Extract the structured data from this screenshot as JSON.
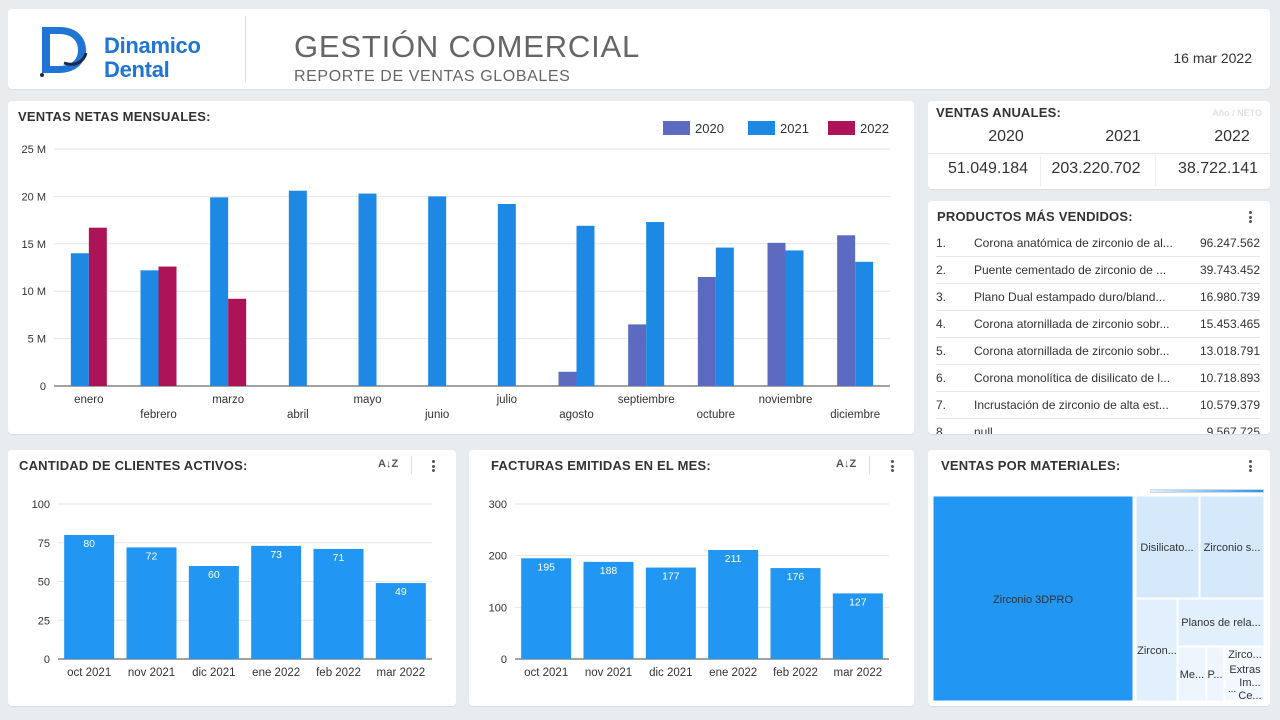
{
  "header": {
    "logo_line1": "Dinamico",
    "logo_line2": "Dental",
    "title": "GESTIÓN COMERCIAL",
    "subtitle": "REPORTE DE VENTAS GLOBALES",
    "date": "16 mar 2022"
  },
  "colors": {
    "c2020": "#5c6bc0",
    "c2021": "#1e88e5",
    "c2022": "#ad1457",
    "bar": "#2196f3",
    "treemap_main": "#2196f3",
    "treemap_light": "#d6e9fb"
  },
  "monthly": {
    "title": "VENTAS NETAS MENSUALES:",
    "legend": [
      "2020",
      "2021",
      "2022"
    ]
  },
  "annual": {
    "title": "VENTAS ANUALES:",
    "hint": "Año / NETO",
    "years": [
      "2020",
      "2021",
      "2022"
    ],
    "values": [
      "51.049.184",
      "203.220.702",
      "38.722.141"
    ]
  },
  "products": {
    "title": "PRODUCTOS MÁS VENDIDOS:",
    "rows": [
      {
        "idx": "1.",
        "name": "Corona anatómica de zirconio de al...",
        "value": "96.247.562"
      },
      {
        "idx": "2.",
        "name": "Puente cementado de zirconio de ...",
        "value": "39.743.452"
      },
      {
        "idx": "3.",
        "name": "Plano Dual estampado duro/bland...",
        "value": "16.980.739"
      },
      {
        "idx": "4.",
        "name": "Corona atornillada de zirconio sobr...",
        "value": "15.453.465"
      },
      {
        "idx": "5.",
        "name": "Corona atornillada de zirconio sobr...",
        "value": "13.018.791"
      },
      {
        "idx": "6.",
        "name": "Corona monolítica de disilicato de l...",
        "value": "10.718.893"
      },
      {
        "idx": "7.",
        "name": "Incrustación de zirconio de alta est...",
        "value": "10.579.379"
      },
      {
        "idx": "8.",
        "name": "null",
        "value": "9.567.725"
      }
    ]
  },
  "clients": {
    "title": "CANTIDAD DE CLIENTES ACTIVOS:"
  },
  "invoices": {
    "title": "FACTURAS EMITIDAS EN EL MES:"
  },
  "materials": {
    "title": "VENTAS POR MATERIALES:",
    "labels": {
      "main": "Zirconio 3DPRO",
      "disilicato": "Disilicato...",
      "zirconio_s": "Zirconio s...",
      "planos": "Planos de rela...",
      "zircon": "Zircon...",
      "me": "Me...",
      "p": "P...",
      "zirco": "Zirco...",
      "extras": "Extras",
      "im": "Im...",
      "dots": "...",
      "ce": "Ce..."
    }
  },
  "chart_data": [
    {
      "type": "bar",
      "title": "VENTAS NETAS MENSUALES:",
      "categories": [
        "enero",
        "febrero",
        "marzo",
        "abril",
        "mayo",
        "junio",
        "julio",
        "agosto",
        "septiembre",
        "octubre",
        "noviembre",
        "diciembre"
      ],
      "series": [
        {
          "name": "2020",
          "values": [
            null,
            null,
            null,
            null,
            null,
            null,
            null,
            1.5,
            6.5,
            11.5,
            15.1,
            15.9
          ]
        },
        {
          "name": "2021",
          "values": [
            14.0,
            12.2,
            19.9,
            20.6,
            20.3,
            20.0,
            19.2,
            16.9,
            17.3,
            14.6,
            14.3,
            13.1
          ]
        },
        {
          "name": "2022",
          "values": [
            16.7,
            12.6,
            9.2,
            null,
            null,
            null,
            null,
            null,
            null,
            null,
            null,
            null
          ]
        }
      ],
      "ylim": [
        0,
        25
      ],
      "yticks": [
        "0",
        "5 M",
        "10 M",
        "15 M",
        "20 M",
        "25 M"
      ],
      "legend": "top-right",
      "grid": true
    },
    {
      "type": "bar",
      "title": "CANTIDAD DE CLIENTES ACTIVOS:",
      "categories": [
        "oct 2021",
        "nov 2021",
        "dic 2021",
        "ene 2022",
        "feb 2022",
        "mar 2022"
      ],
      "values": [
        80,
        72,
        60,
        73,
        71,
        49
      ],
      "ylim": [
        0,
        100
      ],
      "yticks": [
        "0",
        "25",
        "50",
        "75",
        "100"
      ],
      "grid": true
    },
    {
      "type": "bar",
      "title": "FACTURAS EMITIDAS EN EL MES:",
      "categories": [
        "oct 2021",
        "nov 2021",
        "dic 2021",
        "ene 2022",
        "feb 2022",
        "mar 2022"
      ],
      "values": [
        195,
        188,
        177,
        211,
        176,
        127
      ],
      "ylim": [
        0,
        300
      ],
      "yticks": [
        "0",
        "100",
        "200",
        "300"
      ],
      "grid": true
    }
  ]
}
